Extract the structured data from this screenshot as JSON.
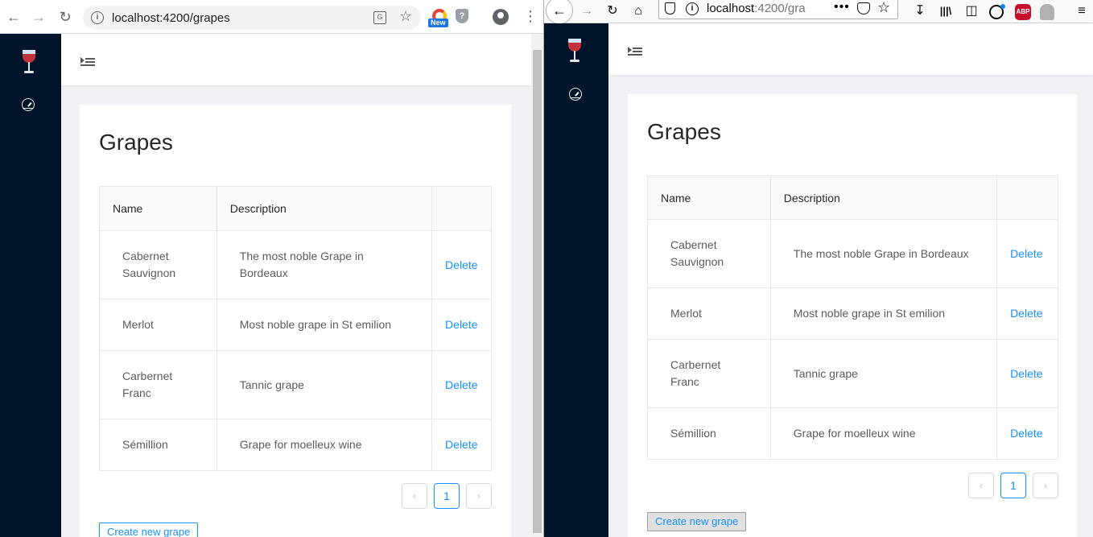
{
  "chrome": {
    "url": "localhost:4200/grapes",
    "new_badge": "New"
  },
  "firefox": {
    "url_host": "localhost",
    "url_rest": ":4200/gra",
    "abp_label": "ABP"
  },
  "app": {
    "title": "Grapes",
    "columns": [
      "Name",
      "Description",
      ""
    ],
    "rows": [
      {
        "name_line1": "Cabernet",
        "name_line2": "Sauvignon",
        "description_chrome_1": "The most noble Grape in",
        "description_chrome_2": "Bordeaux",
        "description": "The most noble Grape in Bordeaux",
        "action": "Delete"
      },
      {
        "name_line1": "Merlot",
        "name_line2": "",
        "description_chrome_1": "Most noble grape in St emilion",
        "description_chrome_2": "",
        "description": "Most noble grape in St emilion",
        "action": "Delete"
      },
      {
        "name_line1": "Carbernet",
        "name_line2": "Franc",
        "description_chrome_1": "Tannic grape",
        "description_chrome_2": "",
        "description": "Tannic grape",
        "action": "Delete"
      },
      {
        "name_line1": "Sémillion",
        "name_line2": "",
        "description_chrome_1": "Grape for moelleux wine",
        "description_chrome_2": "",
        "description": "Grape for moelleux wine",
        "action": "Delete"
      }
    ],
    "pagination": {
      "prev": "‹",
      "current": "1",
      "next": "›"
    },
    "create_button": "Create new grape"
  }
}
